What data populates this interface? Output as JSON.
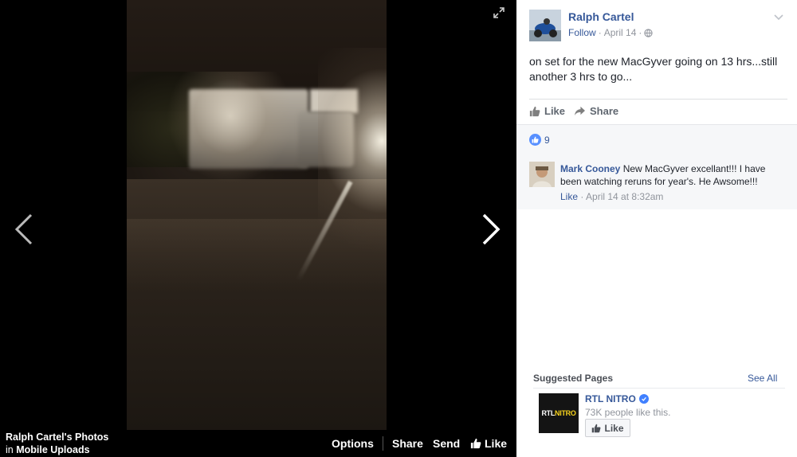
{
  "viewer": {
    "album_owner": "Ralph Cartel's Photos",
    "album_prefix": "in",
    "album_name": "Mobile Uploads",
    "actions": {
      "options": "Options",
      "share": "Share",
      "send": "Send",
      "like": "Like"
    },
    "icons": {
      "prev": "chevron-left-icon",
      "next": "chevron-right-icon",
      "expand": "expand-icon"
    }
  },
  "post": {
    "author": "Ralph Cartel",
    "follow": "Follow",
    "separator": "·",
    "date": "April 14",
    "text": "on set for the new MacGyver going on 13 hrs...still another 3 hrs to go...",
    "actions": {
      "like": "Like",
      "share": "Share"
    },
    "reaction_count": "9"
  },
  "comment": {
    "author": "Mark Cooney",
    "text": "New MacGyver excellant!!! I have been watching reruns for year's. He Awsome!!!",
    "like": "Like",
    "separator": "·",
    "time": "April 14 at 8:32am"
  },
  "suggested": {
    "heading": "Suggested Pages",
    "see_all": "See All",
    "page_name": "RTL NITRO",
    "page_likes": "73K people like this.",
    "like_button": "Like",
    "logo": {
      "white": "RTL",
      "yellow": "NITRO"
    }
  },
  "colors": {
    "link": "#365899",
    "accent_blue": "#5890ff",
    "muted": "#90949c"
  }
}
